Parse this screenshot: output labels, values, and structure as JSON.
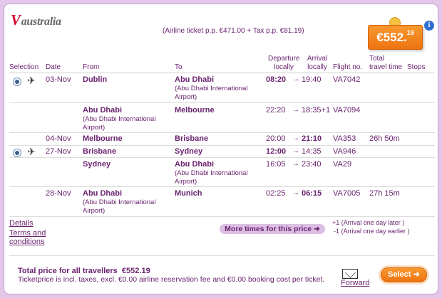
{
  "brand": {
    "logo_v": "V",
    "logo_text": "australia"
  },
  "ticket_info": "(Airline ticket p.p. €471.00 + Tax p.p. €81.19)",
  "price": {
    "main": "€552.",
    "cents": "19"
  },
  "info_icon": "i",
  "headers": {
    "selection": "Selection",
    "date": "Date",
    "from": "From",
    "to": "To",
    "departure": [
      "Departure",
      "locally"
    ],
    "arrival": [
      "Arrival",
      "locally"
    ],
    "flight": "Flight no.",
    "travel_time": [
      "Total",
      "travel time"
    ],
    "stops": "Stops"
  },
  "rows": [
    {
      "date": "03-Nov",
      "from": "Dublin",
      "from_sub": [],
      "to": "Abu Dhabi",
      "to_sub": [
        "(Abu Dhabi International",
        "Airport)"
      ],
      "dep": "08:20",
      "arr": "19:40",
      "flight": "VA7042",
      "time": ""
    },
    {
      "date": "",
      "from": "Abu Dhabi",
      "from_sub": [
        "(Abu Dhabi International",
        "Airport)"
      ],
      "to": "Melbourne",
      "to_sub": [],
      "dep": "22:20",
      "arr": "18:35+1",
      "flight": "VA7094",
      "time": ""
    },
    {
      "date": "04-Nov",
      "from": "Melbourne",
      "from_sub": [],
      "to": "Brisbane",
      "to_sub": [],
      "dep": "20:00",
      "arr": "21:10",
      "flight": "VA353",
      "time": "26h 50m"
    },
    {
      "date": "27-Nov",
      "from": "Brisbane",
      "from_sub": [],
      "to": "Sydney",
      "to_sub": [],
      "dep": "12:00",
      "arr": "14:35",
      "flight": "VA946",
      "time": ""
    },
    {
      "date": "",
      "from": "Sydney",
      "from_sub": [],
      "to": "Abu Dhabi",
      "to_sub": [
        "(Abu Dhabi International",
        "Airport)"
      ],
      "dep": "16:05",
      "arr": "23:40",
      "flight": "VA29",
      "time": ""
    },
    {
      "date": "28-Nov",
      "from": "Abu Dhabi",
      "from_sub": [
        "(Abu Dhabi International",
        "Airport)"
      ],
      "to": "Munich",
      "to_sub": [],
      "dep": "02:25",
      "arr": "06:15",
      "flight": "VA7005",
      "time": "27h 15m"
    }
  ],
  "arrow": "→",
  "links": {
    "details": "Details",
    "terms1": "Terms and",
    "terms2": "conditions"
  },
  "more_times": "More times for this price ➜",
  "legend": {
    "plus": "+1 (Arrival one day later )",
    "minus": "-1 (Arrival one day earlier )"
  },
  "total": {
    "label": "Total price for all travellers",
    "value": "€552.19"
  },
  "note": "Ticketprice is incl. taxes, excl. €0.00 airline reservation fee and €0.00 booking cost per ticket.",
  "forward": "Forward",
  "select": "Select ➜"
}
